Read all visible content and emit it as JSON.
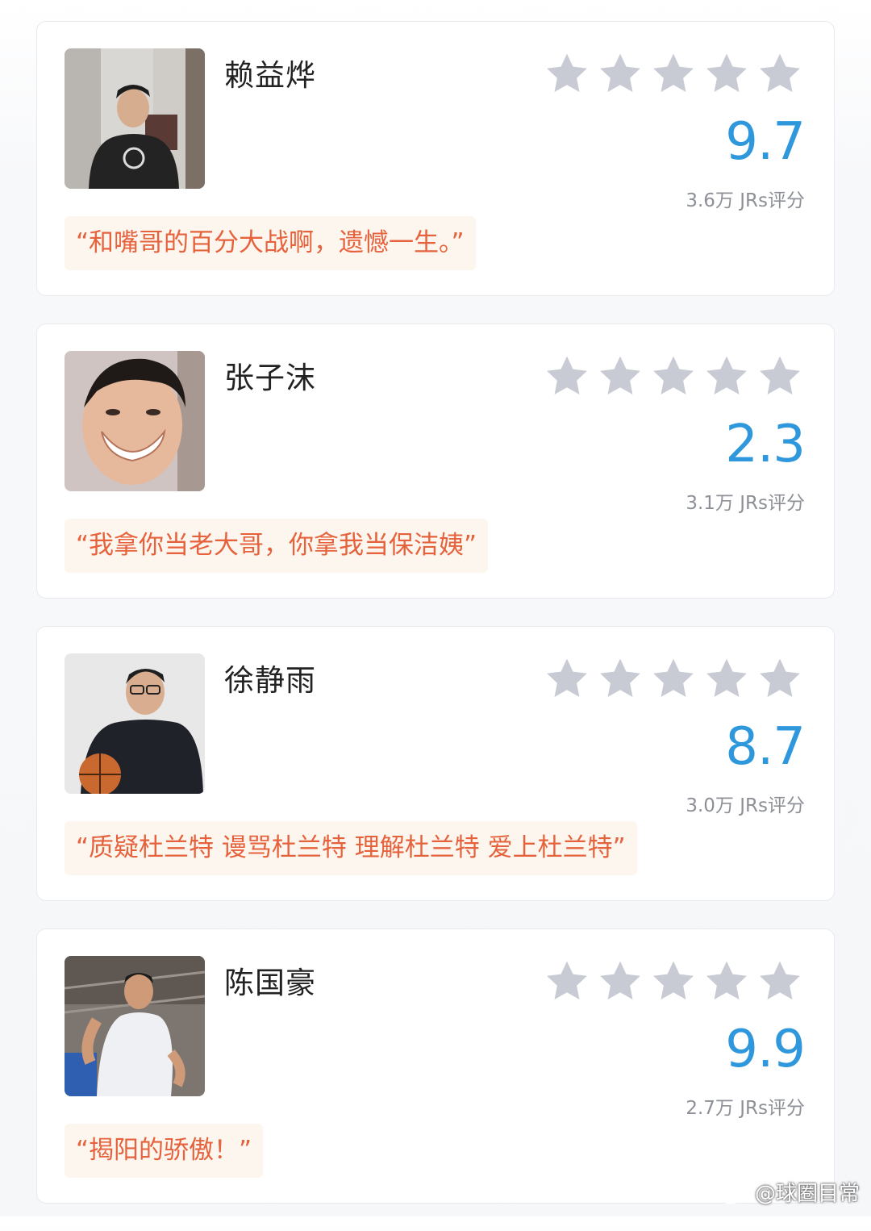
{
  "cards": [
    {
      "name": "赖益烨",
      "score": "9.7",
      "rating_count": "3.6万 JRs评分",
      "quote": "“和嘴哥的百分大战啊，遗憾一生。”",
      "stars_filled": 0,
      "stars_total": 5
    },
    {
      "name": "张子沫",
      "score": "2.3",
      "rating_count": "3.1万 JRs评分",
      "quote": "“我拿你当老大哥，你拿我当保洁姨”",
      "stars_filled": 0,
      "stars_total": 5
    },
    {
      "name": "徐静雨",
      "score": "8.7",
      "rating_count": "3.0万 JRs评分",
      "quote": "“质疑杜兰特 谩骂杜兰特 理解杜兰特 爱上杜兰特”",
      "stars_filled": 0,
      "stars_total": 5
    },
    {
      "name": "陈国豪",
      "score": "9.9",
      "rating_count": "2.7万 JRs评分",
      "quote": "“揭阳的骄傲！”",
      "stars_filled": 0,
      "stars_total": 5
    }
  ],
  "watermark": "@球圈目常",
  "colors": {
    "score": "#2f97dc",
    "quote_text": "#e5623c",
    "quote_bg": "#fdf6ee",
    "star": "#c9cbd4"
  }
}
